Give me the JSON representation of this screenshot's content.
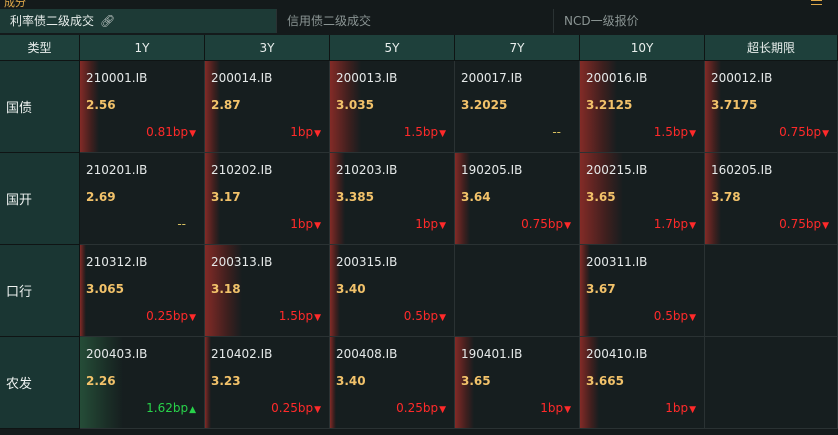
{
  "window": {
    "clipped_title": "成分"
  },
  "tabs": [
    {
      "label": "利率债二级成交",
      "active": true
    },
    {
      "label": "信用债二级成交",
      "active": false
    },
    {
      "label": "NCD一级报价",
      "active": false
    }
  ],
  "headers": [
    "类型",
    "1Y",
    "3Y",
    "5Y",
    "7Y",
    "10Y",
    "超长期限"
  ],
  "rows": [
    {
      "type": "国债",
      "cells": [
        {
          "code": "210001.IB",
          "yield": "2.56",
          "change": "0.81bp",
          "dir": "down",
          "heat": 0.15
        },
        {
          "code": "200014.IB",
          "yield": "2.87",
          "change": "1bp",
          "dir": "down",
          "heat": 0.12
        },
        {
          "code": "200013.IB",
          "yield": "3.035",
          "change": "1.5bp",
          "dir": "down",
          "heat": 0.25
        },
        {
          "code": "200017.IB",
          "yield": "3.2025",
          "change": "--",
          "dir": "flat",
          "heat": 0
        },
        {
          "code": "200016.IB",
          "yield": "3.2125",
          "change": "1.5bp",
          "dir": "down",
          "heat": 0.3
        },
        {
          "code": "200012.IB",
          "yield": "3.7175",
          "change": "0.75bp",
          "dir": "down",
          "heat": 0.12
        }
      ]
    },
    {
      "type": "国开",
      "cells": [
        {
          "code": "210201.IB",
          "yield": "2.69",
          "change": "--",
          "dir": "flat",
          "heat": 0
        },
        {
          "code": "210202.IB",
          "yield": "3.17",
          "change": "1bp",
          "dir": "down",
          "heat": 0.12
        },
        {
          "code": "210203.IB",
          "yield": "3.385",
          "change": "1bp",
          "dir": "down",
          "heat": 0.12
        },
        {
          "code": "190205.IB",
          "yield": "3.64",
          "change": "0.75bp",
          "dir": "down",
          "heat": 0.12
        },
        {
          "code": "200215.IB",
          "yield": "3.65",
          "change": "1.7bp",
          "dir": "down",
          "heat": 0.35
        },
        {
          "code": "160205.IB",
          "yield": "3.78",
          "change": "0.75bp",
          "dir": "down",
          "heat": 0.12
        }
      ]
    },
    {
      "type": "口行",
      "cells": [
        {
          "code": "210312.IB",
          "yield": "3.065",
          "change": "0.25bp",
          "dir": "down",
          "heat": 0.05
        },
        {
          "code": "200313.IB",
          "yield": "3.18",
          "change": "1.5bp",
          "dir": "down",
          "heat": 0.3
        },
        {
          "code": "200315.IB",
          "yield": "3.40",
          "change": "0.5bp",
          "dir": "down",
          "heat": 0.08
        },
        {
          "code": "",
          "yield": "",
          "change": "",
          "dir": "none",
          "heat": 0
        },
        {
          "code": "200311.IB",
          "yield": "3.67",
          "change": "0.5bp",
          "dir": "down",
          "heat": 0.08
        },
        {
          "code": "",
          "yield": "",
          "change": "",
          "dir": "none",
          "heat": 0
        }
      ]
    },
    {
      "type": "农发",
      "cells": [
        {
          "code": "200403.IB",
          "yield": "2.26",
          "change": "1.62bp",
          "dir": "up",
          "heat": 0.35
        },
        {
          "code": "210402.IB",
          "yield": "3.23",
          "change": "0.25bp",
          "dir": "down",
          "heat": 0.05
        },
        {
          "code": "200408.IB",
          "yield": "3.40",
          "change": "0.25bp",
          "dir": "down",
          "heat": 0.05
        },
        {
          "code": "190401.IB",
          "yield": "3.65",
          "change": "1bp",
          "dir": "down",
          "heat": 0.15
        },
        {
          "code": "200410.IB",
          "yield": "3.665",
          "change": "1bp",
          "dir": "down",
          "heat": 0.15
        },
        {
          "code": "",
          "yield": "",
          "change": "",
          "dir": "none",
          "heat": 0
        }
      ]
    }
  ],
  "icons": {
    "link": "link-icon",
    "menu": "menu-icon",
    "down": "triangle-down-icon",
    "up": "triangle-up-icon"
  },
  "colors": {
    "down": "#ff2a2a",
    "up": "#28d24a",
    "yield": "#f2c26a",
    "header_bg": "#1e403b"
  }
}
